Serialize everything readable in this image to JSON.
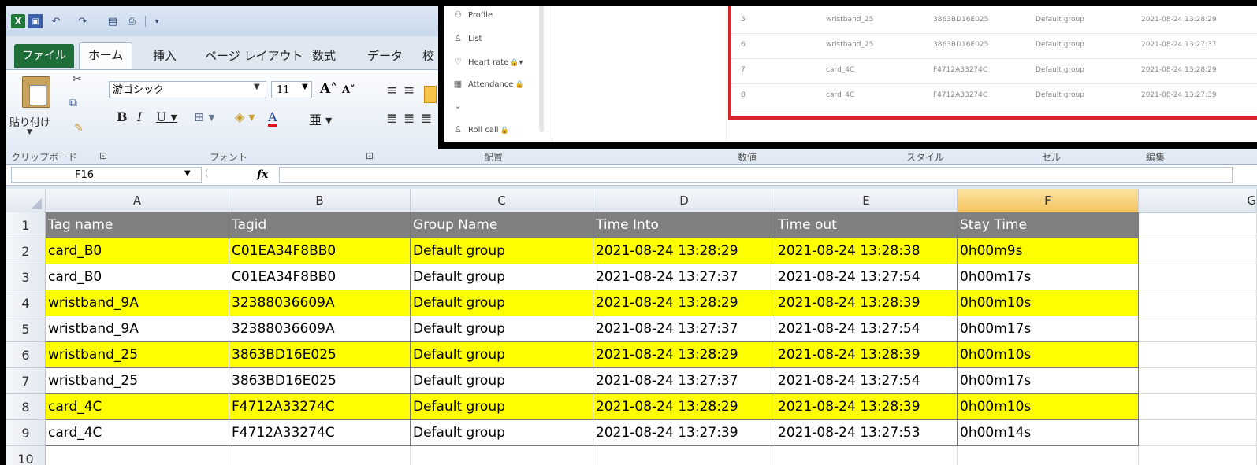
{
  "quick_access": {
    "excel_logo": "X",
    "more": "▾"
  },
  "tabs": [
    {
      "label": "ファイル"
    },
    {
      "label": "ホーム"
    },
    {
      "label": "挿入"
    },
    {
      "label": "ページ レイアウト"
    },
    {
      "label": "数式"
    },
    {
      "label": "データ"
    },
    {
      "label": "校"
    }
  ],
  "ribbon": {
    "paste_label": "貼り付け",
    "font_name": "游ゴシック",
    "font_size": "11",
    "groups": {
      "clipboard": "クリップボード",
      "font": "フォント",
      "alignment": "配置",
      "number": "数値",
      "styles": "スタイル",
      "cells": "セル",
      "editing": "編集"
    }
  },
  "formula_bar": {
    "name_box": "F16",
    "fx": "fx",
    "value": ""
  },
  "sheet": {
    "columns": [
      "A",
      "B",
      "C",
      "D",
      "E",
      "F",
      "G"
    ],
    "selected_column": "F",
    "header": [
      "Tag name",
      "Tagid",
      "Group Name",
      "Time Into",
      "Time out",
      "Stay Time"
    ],
    "rows": [
      {
        "n": "1"
      },
      {
        "n": "2",
        "cells": [
          "card_B0",
          "C01EA34F8BB0",
          "Default group",
          "2021-08-24 13:28:29",
          "2021-08-24 13:28:38",
          "0h00m9s"
        ],
        "highlight": true
      },
      {
        "n": "3",
        "cells": [
          "card_B0",
          "C01EA34F8BB0",
          "Default group",
          "2021-08-24 13:27:37",
          "2021-08-24 13:27:54",
          "0h00m17s"
        ],
        "highlight": false
      },
      {
        "n": "4",
        "cells": [
          "wristband_9A",
          "32388036609A",
          "Default group",
          "2021-08-24 13:28:29",
          "2021-08-24 13:28:39",
          "0h00m10s"
        ],
        "highlight": true
      },
      {
        "n": "5",
        "cells": [
          "wristband_9A",
          "32388036609A",
          "Default group",
          "2021-08-24 13:27:37",
          "2021-08-24 13:27:54",
          "0h00m17s"
        ],
        "highlight": false
      },
      {
        "n": "6",
        "cells": [
          "wristband_25",
          "3863BD16E025",
          "Default group",
          "2021-08-24 13:28:29",
          "2021-08-24 13:28:39",
          "0h00m10s"
        ],
        "highlight": true
      },
      {
        "n": "7",
        "cells": [
          "wristband_25",
          "3863BD16E025",
          "Default group",
          "2021-08-24 13:27:37",
          "2021-08-24 13:27:54",
          "0h00m17s"
        ],
        "highlight": false
      },
      {
        "n": "8",
        "cells": [
          "card_4C",
          "F4712A33274C",
          "Default group",
          "2021-08-24 13:28:29",
          "2021-08-24 13:28:39",
          "0h00m10s"
        ],
        "highlight": true
      },
      {
        "n": "9",
        "cells": [
          "card_4C",
          "F4712A33274C",
          "Default group",
          "2021-08-24 13:27:39",
          "2021-08-24 13:27:53",
          "0h00m14s"
        ],
        "highlight": false
      },
      {
        "n": "10"
      }
    ],
    "colors": {
      "header_bg": "#808080",
      "highlight": "#ffff00"
    }
  },
  "overlay": {
    "menu": [
      {
        "label": "Profile",
        "icon": "profile-icon",
        "locked": false
      },
      {
        "label": "List",
        "icon": "person-icon",
        "locked": false
      },
      {
        "label": "Heart rate",
        "icon": "heart-rate-icon",
        "locked": true,
        "expand": "▾"
      },
      {
        "label": "Attendance",
        "icon": "calendar-icon",
        "locked": true
      },
      {
        "label": "",
        "icon": "chevron-down-icon",
        "locked": false
      },
      {
        "label": "Roll call",
        "icon": "person-icon",
        "locked": true
      }
    ],
    "table_rows": [
      {
        "index": "5",
        "name": "wristband_25",
        "tagid": "3863BD16E025",
        "group": "Default group",
        "time": "2021-08-24 13:28:29"
      },
      {
        "index": "6",
        "name": "wristband_25",
        "tagid": "3863BD16E025",
        "group": "Default group",
        "time": "2021-08-24 13:27:37"
      },
      {
        "index": "7",
        "name": "card_4C",
        "tagid": "F4712A33274C",
        "group": "Default group",
        "time": "2021-08-24 13:28:29"
      },
      {
        "index": "8",
        "name": "card_4C",
        "tagid": "F4712A33274C",
        "group": "Default group",
        "time": "2021-08-24 13:27:39"
      }
    ],
    "highlight_color": "#d8242c"
  }
}
